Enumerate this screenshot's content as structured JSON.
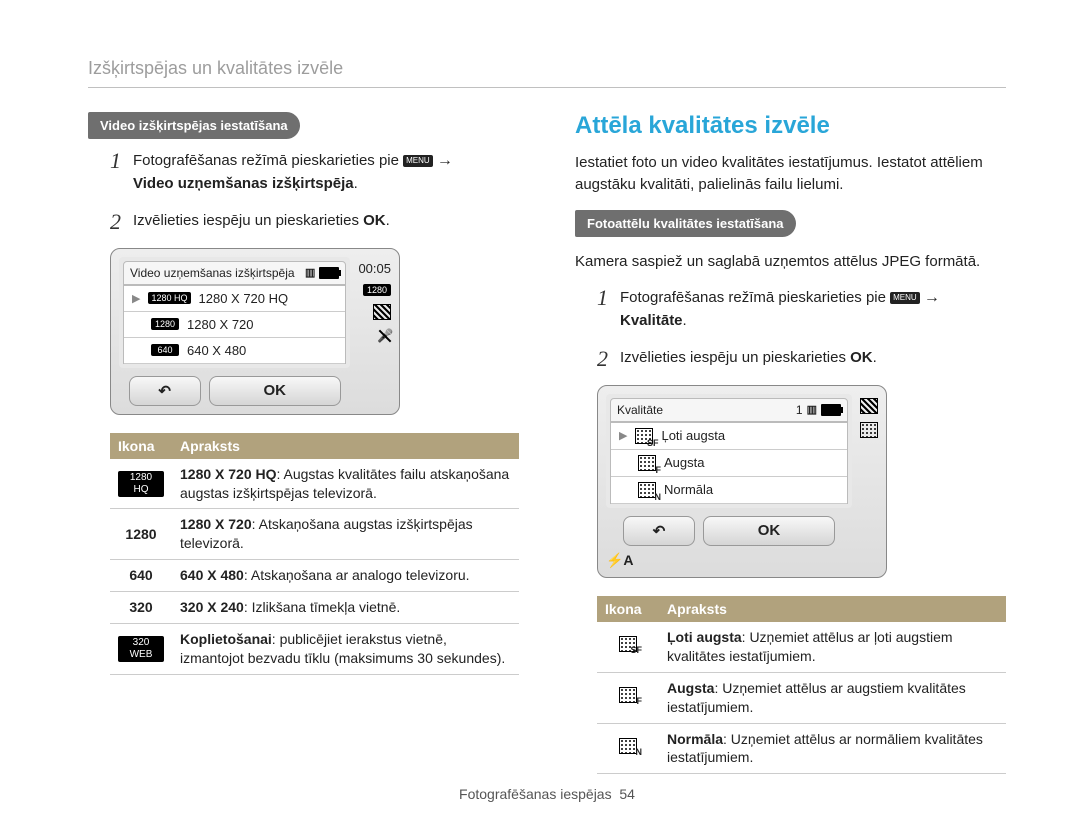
{
  "header": "Izšķirtspējas un kvalitātes izvēle",
  "left": {
    "tag": "Video izšķirtspējas iestatīšana",
    "step1_pre": "Fotografēšanas režīmā pieskarieties pie ",
    "step1_menu": "MENU",
    "step1_arrow": " → ",
    "step1_bold": "Video uzņemšanas izšķirtspēja",
    "step1_end": ".",
    "step2_pre": "Izvēlieties iespēju un pieskarieties ",
    "step2_ok": "OK",
    "step2_end": ".",
    "device": {
      "title": "Video uzņemšanas izšķirtspēja",
      "time": "00:05",
      "rows": [
        {
          "icon": "1280 HQ",
          "label": "1280 X 720 HQ",
          "selected": true
        },
        {
          "icon": "1280",
          "label": "1280 X 720",
          "selected": false
        },
        {
          "icon": "640",
          "label": "640 X 480",
          "selected": false
        }
      ],
      "back": "↶",
      "ok": "OK"
    },
    "table": {
      "h1": "Ikona",
      "h2": "Apraksts",
      "rows": [
        {
          "icon_kind": "badge",
          "icon": "1280\nHQ",
          "bold": "1280 X 720 HQ",
          "text": ": Augstas kvalitātes failu atskaņošana augstas izšķirtspējas televizorā."
        },
        {
          "icon_kind": "text",
          "icon": "1280",
          "bold": "1280 X 720",
          "text": ": Atskaņošana augstas izšķirtspējas televizorā."
        },
        {
          "icon_kind": "text",
          "icon": "640",
          "bold": "640 X 480",
          "text": ": Atskaņošana ar analogo televizoru."
        },
        {
          "icon_kind": "text",
          "icon": "320",
          "bold": "320 X 240",
          "text": ": Izlikšana tīmekļa vietnē."
        },
        {
          "icon_kind": "badge",
          "icon": "320\nWEB",
          "bold": "Koplietošanai",
          "text": ": publicējiet ierakstus vietnē, izmantojot bezvadu tīklu (maksimums 30 sekundes)."
        }
      ]
    }
  },
  "right": {
    "title": "Attēla kvalitātes izvēle",
    "intro": "Iestatiet foto un video kvalitātes iestatījumus. Iestatot attēliem augstāku kvalitāti, palielinās failu lielumi.",
    "tag": "Fotoattēlu kvalitātes iestatīšana",
    "note": "Kamera saspiež un saglabā uzņemtos attēlus JPEG formātā.",
    "step1_pre": "Fotografēšanas režīmā pieskarieties pie ",
    "step1_menu": "MENU",
    "step1_arrow": " → ",
    "step1_bold": "Kvalitāte",
    "step1_end": ".",
    "step2_pre": "Izvēlieties iespēju un pieskarieties ",
    "step2_ok": "OK",
    "step2_end": ".",
    "device": {
      "title": "Kvalitāte",
      "count": "1",
      "rows": [
        {
          "sub": "SF",
          "label": "Ļoti augsta",
          "selected": true
        },
        {
          "sub": "F",
          "label": "Augsta",
          "selected": false
        },
        {
          "sub": "N",
          "label": "Normāla",
          "selected": false
        }
      ],
      "back": "↶",
      "ok": "OK",
      "flash": "⚡A"
    },
    "table": {
      "h1": "Ikona",
      "h2": "Apraksts",
      "rows": [
        {
          "sub": "SF",
          "bold": "Ļoti augsta",
          "text": ": Uzņemiet attēlus ar ļoti augstiem kvalitātes iestatījumiem."
        },
        {
          "sub": "F",
          "bold": "Augsta",
          "text": ": Uzņemiet attēlus ar augstiem kvalitātes iestatījumiem."
        },
        {
          "sub": "N",
          "bold": "Normāla",
          "text": ": Uzņemiet attēlus ar normāliem kvalitātes iestatījumiem."
        }
      ]
    }
  },
  "footer": {
    "section": "Fotografēšanas iespējas",
    "page": "54"
  }
}
